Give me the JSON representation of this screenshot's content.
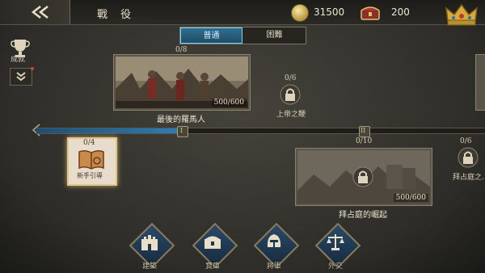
{
  "header": {
    "title": "戰 役",
    "gold": "31500",
    "gems": "200"
  },
  "sidebar": {
    "achievements_label": "成就"
  },
  "tabs": [
    {
      "label": "普通",
      "active": true
    },
    {
      "label": "困難",
      "active": false
    }
  ],
  "missions": {
    "last_romans": {
      "name": "最後的羅馬人",
      "progress": "0/8",
      "cost": "500/600"
    },
    "god_wrath": {
      "name": "上帝之鞭",
      "progress": "0/6"
    },
    "byzantium": {
      "name": "拜占庭的崛起",
      "progress": "0/10",
      "cost": "500/600"
    },
    "byz_right": {
      "name": "拜占庭之…",
      "progress": "0/6"
    },
    "tutorial": {
      "name": "新手引導",
      "progress": "0/4"
    }
  },
  "track_nodes": [
    "I",
    "II"
  ],
  "bottom": [
    {
      "label": "建築",
      "icon": "castle-icon"
    },
    {
      "label": "寶庫",
      "icon": "chest-icon"
    },
    {
      "label": "將軍",
      "icon": "helmet-icon"
    },
    {
      "label": "外交",
      "icon": "scales-icon"
    }
  ],
  "colors": {
    "accent_blue": "#2e7cb3",
    "gold": "#c9a448"
  }
}
